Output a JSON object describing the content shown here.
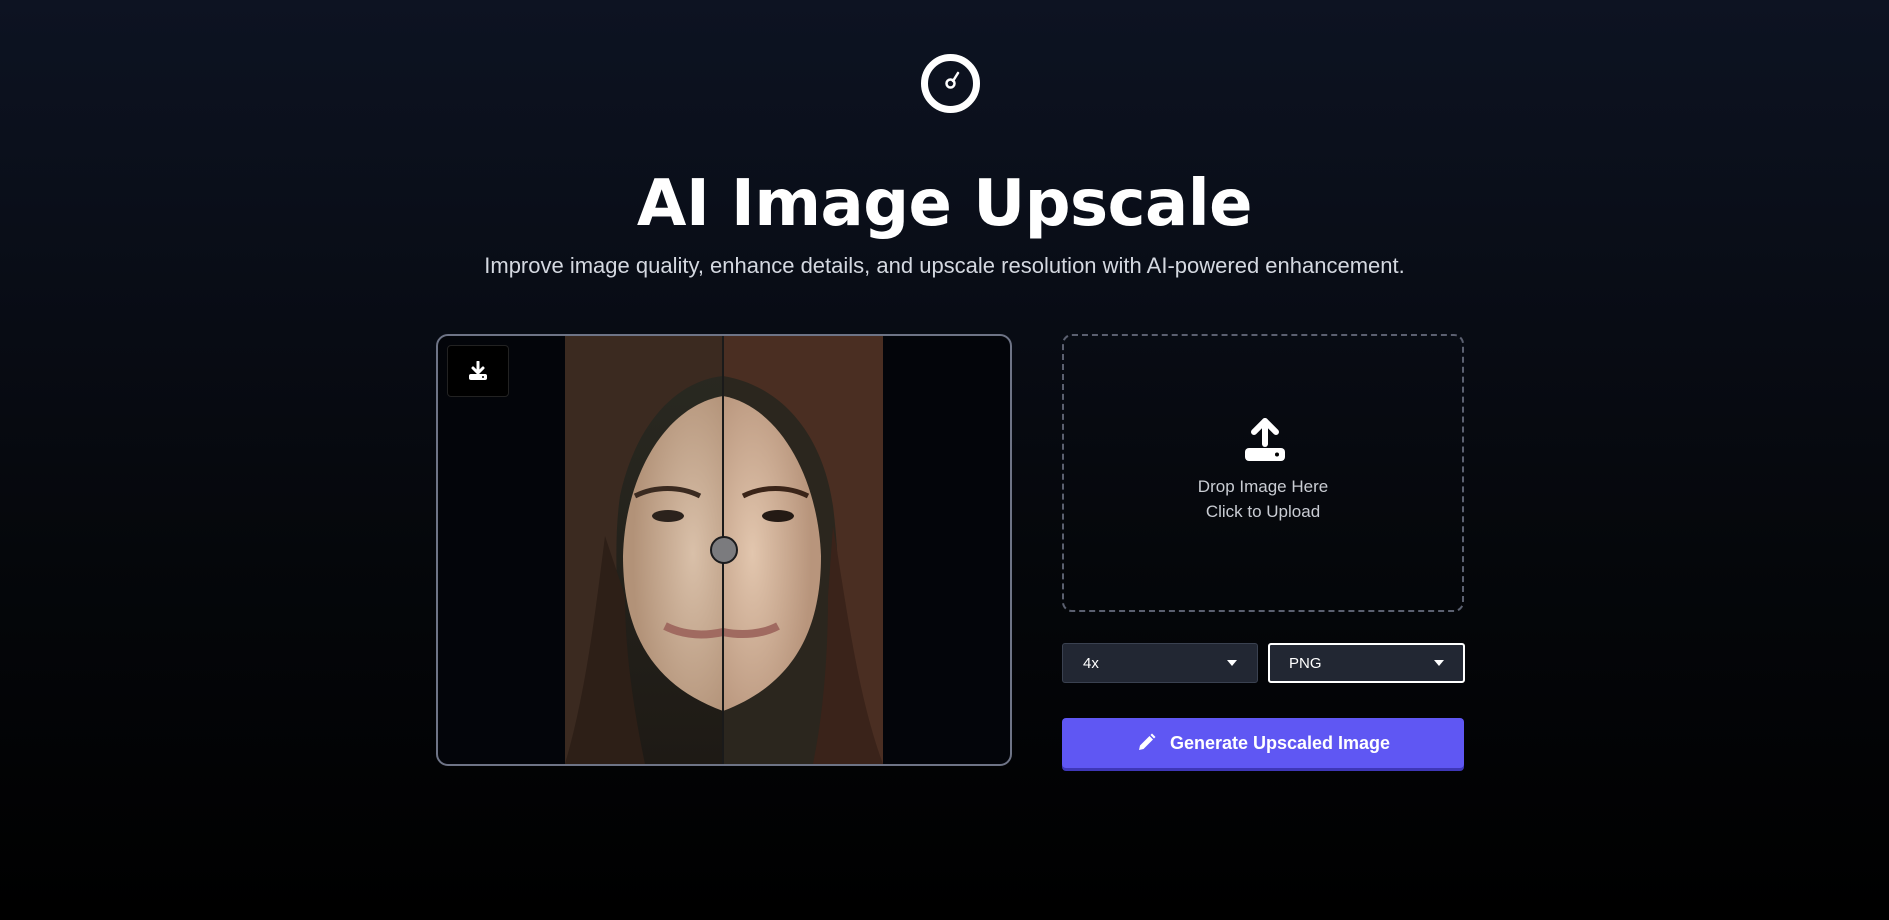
{
  "header": {
    "logo_icon": "gauge-icon",
    "title": "AI Image Upscale",
    "subtitle": "Improve image quality, enhance details, and upscale resolution with AI-powered enhancement."
  },
  "preview": {
    "download_icon": "download-icon",
    "comparison_split": 0.5
  },
  "upload": {
    "icon": "upload-icon",
    "line1": "Drop Image Here",
    "line2": "Click to Upload"
  },
  "options": {
    "scale_value": "4x",
    "format_value": "PNG"
  },
  "actions": {
    "generate_label": "Generate Upscaled Image",
    "generate_icon": "pencil-icon"
  },
  "colors": {
    "accent": "#5f57f3",
    "background_top": "#0d1322",
    "background_bottom": "#000000"
  }
}
